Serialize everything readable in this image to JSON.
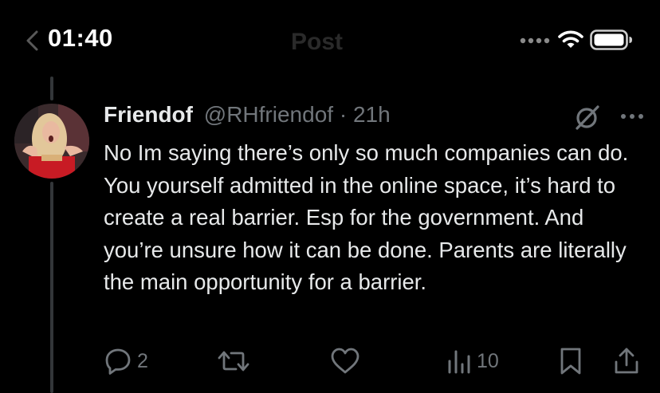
{
  "status_bar": {
    "time": "01:40",
    "header_title": "Post",
    "icons": [
      "back-chevron-icon",
      "cellular-signal-icon",
      "wifi-icon",
      "battery-icon"
    ]
  },
  "tweet": {
    "display_name": "Friendof",
    "handle": "@RHfriendof",
    "separator": "·",
    "age": "21h",
    "text": "No Im saying there’s only so much companies can do. You yourself admitted in the online space, it’s hard to create a real barrier. Esp for the government. And you’re unsure how it can be done. Parents are literally the main opportunity for a barrier.",
    "header_icons": [
      "grok-icon",
      "more-icon"
    ]
  },
  "actions": {
    "reply_count": "2",
    "repost_count": "",
    "like_count": "",
    "views_count": "10",
    "icons": [
      "reply-icon",
      "repost-icon",
      "like-icon",
      "views-icon",
      "bookmark-icon",
      "share-icon"
    ]
  },
  "colors": {
    "background": "#000000",
    "text_primary": "#e7e9ea",
    "text_secondary": "#71767b",
    "thread_line": "#333639"
  }
}
